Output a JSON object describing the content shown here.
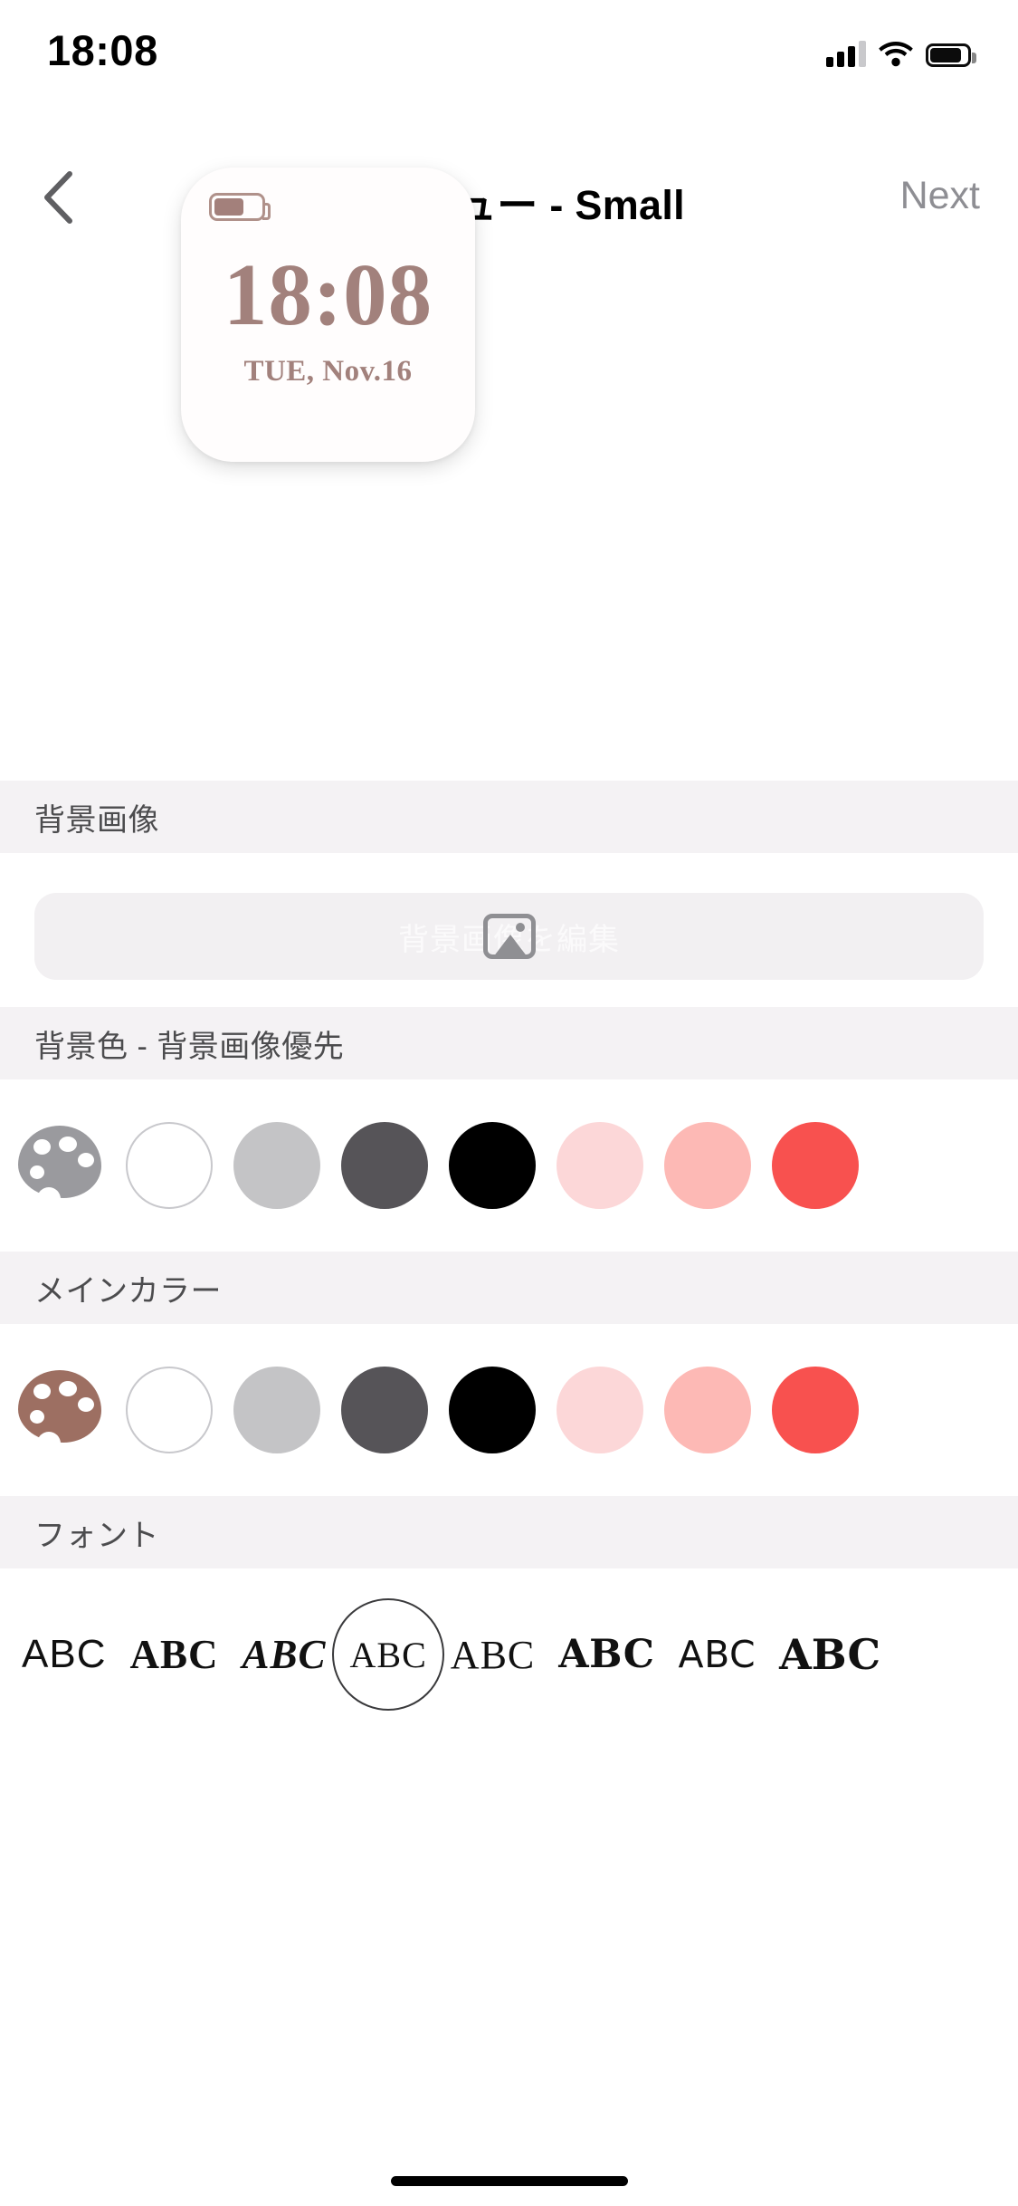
{
  "status_bar": {
    "time": "18:08",
    "icons": [
      "cellular-signal-icon",
      "wifi-icon",
      "battery-icon"
    ]
  },
  "nav_bar": {
    "back_icon": "chevron-left-icon",
    "title": "プレビュー - Small",
    "next_label": "Next"
  },
  "widget_preview": {
    "battery_icon": "battery-icon",
    "battery_level_percent": 58,
    "time": "18:08",
    "date": "TUE, Nov.16",
    "accent_color": "#a2817c",
    "card_background": "#fffdfd"
  },
  "sections": {
    "background_image": {
      "header": "背景画像",
      "button_label": "背景画像を編集",
      "button_icon": "photo-placeholder-icon"
    },
    "background_color": {
      "header": "背景色 - 背景画像優先",
      "palette_icon": "palette-icon",
      "palette_icon_color": "#9a9a9e",
      "swatches": [
        {
          "name": "white",
          "color": "#ffffff",
          "outlined": true
        },
        {
          "name": "light-gray",
          "color": "#c4c4c6",
          "outlined": false
        },
        {
          "name": "dark-gray",
          "color": "#565458",
          "outlined": false
        },
        {
          "name": "black",
          "color": "#000000",
          "outlined": false
        },
        {
          "name": "pale-pink",
          "color": "#fcd7d8",
          "outlined": false
        },
        {
          "name": "soft-pink",
          "color": "#fdb9b5",
          "outlined": false
        },
        {
          "name": "coral-red",
          "color": "#f8514f",
          "outlined": false
        }
      ]
    },
    "main_color": {
      "header": "メインカラー",
      "palette_icon": "palette-icon",
      "palette_icon_color": "#9d6f62",
      "swatches": [
        {
          "name": "white",
          "color": "#ffffff",
          "outlined": true
        },
        {
          "name": "light-gray",
          "color": "#c4c4c6",
          "outlined": false
        },
        {
          "name": "dark-gray",
          "color": "#565458",
          "outlined": false
        },
        {
          "name": "black",
          "color": "#000000",
          "outlined": false
        },
        {
          "name": "pale-pink",
          "color": "#fcd7d8",
          "outlined": false
        },
        {
          "name": "soft-pink",
          "color": "#fdb9b5",
          "outlined": false
        },
        {
          "name": "coral-red",
          "color": "#f8514f",
          "outlined": false
        }
      ]
    },
    "font": {
      "header": "フォント",
      "selected_index": 3,
      "samples": [
        {
          "name": "font-sans",
          "label": "ABC"
        },
        {
          "name": "font-serif-bold",
          "label": "ABC"
        },
        {
          "name": "font-serif-italic",
          "label": "ABC"
        },
        {
          "name": "font-serif-regular",
          "label": "ABC"
        },
        {
          "name": "font-serif-light",
          "label": "ABC"
        },
        {
          "name": "font-slab-bold",
          "label": "ABC"
        },
        {
          "name": "font-grotesk",
          "label": "ABC"
        },
        {
          "name": "font-display-heavy",
          "label": "ABC"
        }
      ]
    }
  }
}
